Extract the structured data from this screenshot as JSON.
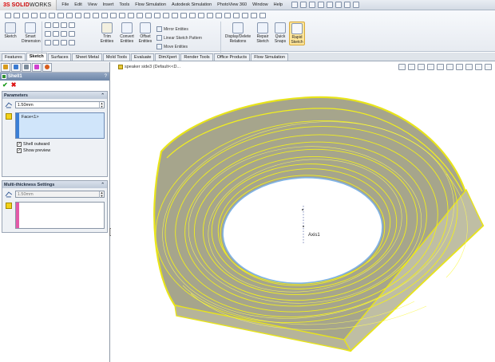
{
  "app": {
    "brand_prefix": "3S",
    "brand_solid": "SOLID",
    "brand_works": "WORKS"
  },
  "menu": [
    "File",
    "Edit",
    "View",
    "Insert",
    "Tools",
    "Flow Simulation",
    "Autodesk Simulation",
    "PhotoView 360",
    "Window",
    "Help"
  ],
  "ribbon": {
    "sketch": "Sketch",
    "smart_dimension": "Smart Dimension",
    "trim": "Trim Entities",
    "convert": "Convert Entities",
    "offset": "Offset Entities",
    "mirror": "Mirror Entities",
    "linear_pattern": "Linear Sketch Pattern",
    "move": "Move Entities",
    "display_delete": "Display/Delete Relations",
    "repair": "Repair Sketch",
    "quick_snaps": "Quick Snaps",
    "rapid_sketch": "Rapid Sketch"
  },
  "tabs": [
    "Features",
    "Sketch",
    "Surfaces",
    "Sheet Metal",
    "Mold Tools",
    "Evaluate",
    "DimXpert",
    "Render Tools",
    "Office Products",
    "Flow Simulation"
  ],
  "active_tab": "Sketch",
  "property_manager": {
    "title": "Shell1",
    "help": "?",
    "ok": "✔",
    "cancel": "✖",
    "parameters": {
      "heading": "Parameters",
      "thickness": "1.50mm",
      "faces": "Face<1>",
      "shell_outward": "Shell outward",
      "show_preview": "Show preview",
      "shell_outward_checked": true,
      "show_preview_checked": true
    },
    "multi": {
      "heading": "Multi-thickness Settings",
      "thickness": "1.50mm"
    }
  },
  "viewport": {
    "tree_flyout": "speaker side3 (Default<<D...",
    "axis_label": "Axis1"
  },
  "colors": {
    "preview_yellow": "#f1ef1e",
    "body_gray": "#a6a58c",
    "face_blue": "#d0e5fa",
    "strip_pink": "#e35aa8",
    "strip_blue": "#3b7fd6"
  }
}
